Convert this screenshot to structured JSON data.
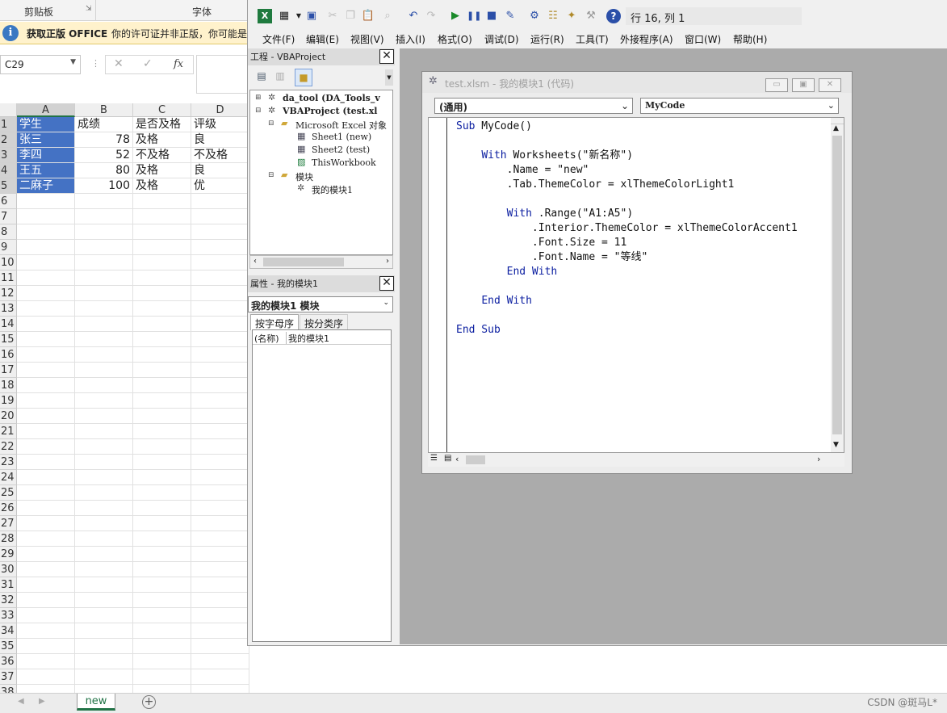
{
  "excel": {
    "ribbon": {
      "clipboard_label": "剪贴板",
      "font_label": "字体"
    },
    "infobar": {
      "title": "获取正版 OFFICE",
      "message": "你的许可证并非正版，你可能是"
    },
    "name_box": "C29",
    "columns": [
      "A",
      "B",
      "C",
      "D"
    ],
    "rows": [
      [
        "学生",
        "成绩",
        "是否及格",
        "评级"
      ],
      [
        "张三",
        "78",
        "及格",
        "良"
      ],
      [
        "李四",
        "52",
        "不及格",
        "不及格"
      ],
      [
        "王五",
        "80",
        "及格",
        "良"
      ],
      [
        "二麻子",
        "100",
        "及格",
        "优"
      ]
    ],
    "row_numbers": [
      "1",
      "2",
      "3",
      "4",
      "5",
      "6",
      "7",
      "8",
      "9",
      "10",
      "11",
      "12",
      "13",
      "14",
      "15",
      "16",
      "17",
      "18",
      "19",
      "20",
      "21",
      "22",
      "23",
      "24",
      "25",
      "26",
      "27",
      "28",
      "29",
      "30",
      "31",
      "32",
      "33",
      "34",
      "35",
      "36",
      "37",
      "38"
    ],
    "sheet_tab": "new",
    "add_sheet_icon": "plus-circle-icon",
    "watermark": "CSDN @斑马L*"
  },
  "vbe": {
    "cursor_position": "行 16, 列 1",
    "menu": [
      "文件(F)",
      "编辑(E)",
      "视图(V)",
      "插入(I)",
      "格式(O)",
      "调试(D)",
      "运行(R)",
      "工具(T)",
      "外接程序(A)",
      "窗口(W)",
      "帮助(H)"
    ],
    "project_panel": {
      "title": "工程 - VBAProject",
      "items": [
        "da_tool (DA_Tools_v",
        "VBAProject (test.xl",
        "Microsoft Excel 对象",
        "Sheet1 (new)",
        "Sheet2 (test)",
        "ThisWorkbook",
        "模块",
        "我的模块1"
      ]
    },
    "properties_panel": {
      "title": "属性 - 我的模块1",
      "object": "我的模块1 模块",
      "tab_alpha": "按字母序",
      "tab_category": "按分类序",
      "row_name": "(名称)",
      "row_value": "我的模块1"
    },
    "code_window": {
      "title": "test.xlsm - 我的模块1 (代码)",
      "object_combo": "(通用)",
      "proc_combo": "MyCode",
      "lines": [
        "Sub MyCode()",
        "",
        "    With Worksheets(\"新名称\")",
        "        .Name = \"new\"",
        "        .Tab.ThemeColor = xlThemeColorLight1",
        "",
        "        With .Range(\"A1:A5\")",
        "            .Interior.ThemeColor = xlThemeColorAccent1",
        "            .Font.Size = 11",
        "            .Font.Name = \"等线\"",
        "        End With",
        "",
        "    End With",
        "",
        "End Sub"
      ]
    }
  }
}
